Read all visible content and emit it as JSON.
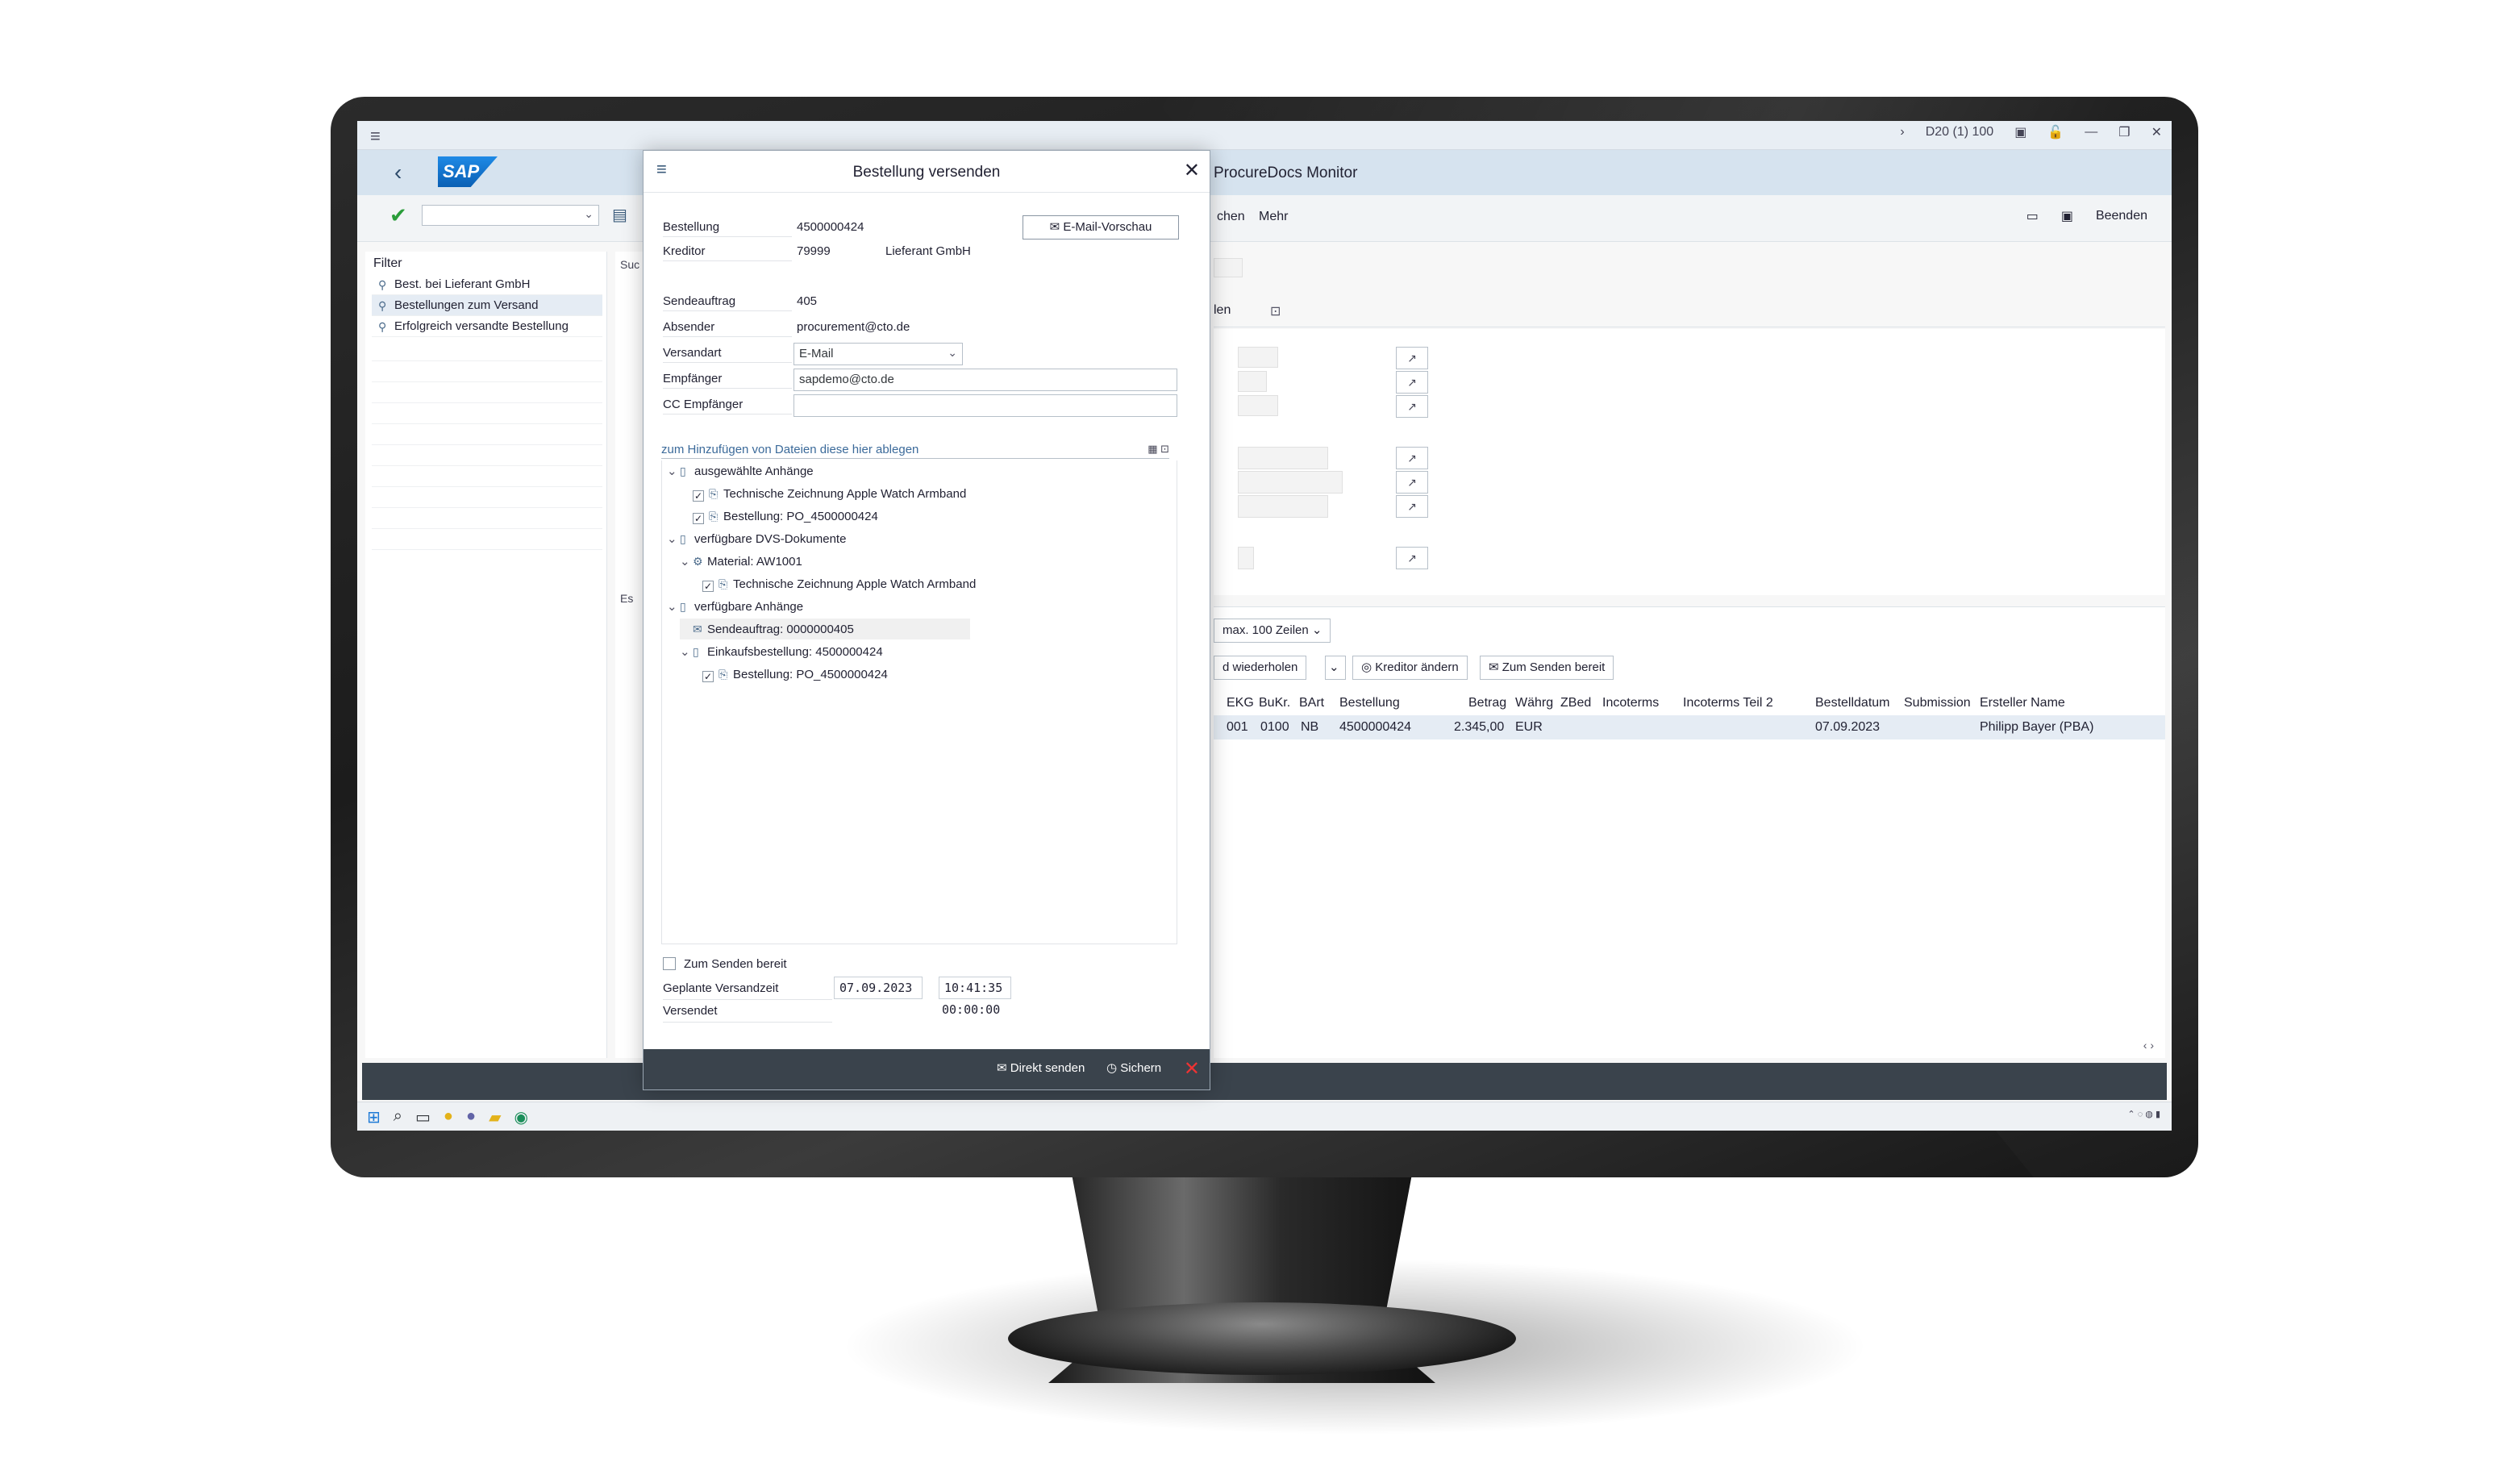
{
  "window": {
    "system": "D20 (1) 100",
    "app_title": "ProcureDocs Monitor"
  },
  "toolbar": {
    "left_label": "chen",
    "more": "Mehr",
    "exit": "Beenden"
  },
  "filter": {
    "heading": "Filter",
    "items": [
      "Best. bei Lieferant GmbH",
      "Bestellungen zum Versand",
      "Erfolgreich versandte Bestellung"
    ]
  },
  "side_strip": [
    "Suc",
    "Es"
  ],
  "detail": {
    "tab_label": "len",
    "list_buttons": {
      "max_rows": "max. 100 Zeilen",
      "repeat": "d wiederholen",
      "change_vendor": "Kreditor ändern",
      "ready_send": "Zum Senden bereit"
    },
    "table": {
      "headers": [
        "EKG",
        "BuKr.",
        "BArt",
        "Bestellung",
        "Betrag",
        "Währg",
        "ZBed",
        "Incoterms",
        "Incoterms Teil 2",
        "Bestelldatum",
        "Submission",
        "Ersteller Name"
      ],
      "row": [
        "001",
        "0100",
        "NB",
        "4500000424",
        "2.345,00",
        "EUR",
        "",
        "",
        "",
        "07.09.2023",
        "",
        "Philipp Bayer (PBA)"
      ]
    }
  },
  "dialog": {
    "title": "Bestellung versenden",
    "email_preview": "E-Mail-Vorschau",
    "fields": {
      "order_label": "Bestellung",
      "order_value": "4500000424",
      "vendor_label": "Kreditor",
      "vendor_id": "79999",
      "vendor_name": "Lieferant GmbH",
      "job_label": "Sendeauftrag",
      "job_value": "405",
      "sender_label": "Absender",
      "sender_value": "procurement@cto.de",
      "method_label": "Versandart",
      "method_value": "E-Mail",
      "recipient_label": "Empfänger",
      "recipient_value": "sapdemo@cto.de",
      "cc_label": "CC Empfänger",
      "cc_value": ""
    },
    "dropzone": "zum Hinzufügen von Dateien diese hier ablegen",
    "tree": {
      "selected_folder": "ausgewählte Anhänge",
      "selected_1": "Technische Zeichnung Apple Watch Armband",
      "selected_2": "Bestellung: PO_4500000424",
      "dms_folder": "verfügbare DVS-Dokumente",
      "material": "Material: AW1001",
      "material_doc": "Technische Zeichnung Apple Watch Armband",
      "avail_folder": "verfügbare Anhänge",
      "send_job": "Sendeauftrag: 0000000405",
      "purchase_order": "Einkaufsbestellung: 4500000424",
      "po_doc": "Bestellung: PO_4500000424"
    },
    "ready_label": "Zum Senden bereit",
    "planned_label": "Geplante Versandzeit",
    "planned_date": "07.09.2023",
    "planned_time": "10:41:35",
    "sent_label": "Versendet",
    "sent_time": "00:00:00",
    "footer": {
      "send_direct": "Direkt senden",
      "save": "Sichern"
    }
  }
}
